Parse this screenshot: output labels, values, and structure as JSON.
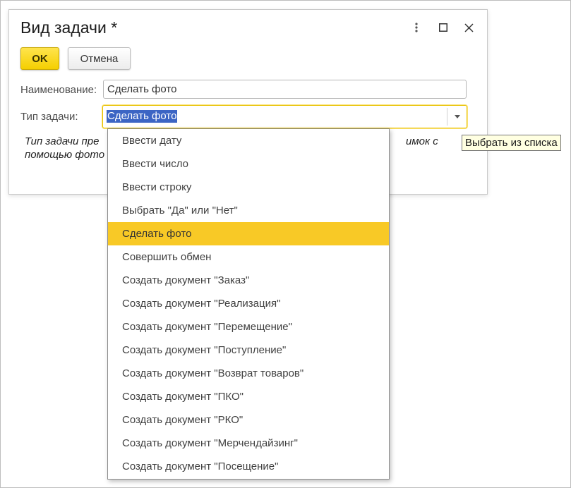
{
  "dialog": {
    "title": "Вид задачи *",
    "buttons": {
      "ok": "OK",
      "cancel": "Отмена"
    },
    "fields": {
      "name_label": "Наименование:",
      "name_value": "Сделать фото",
      "type_label": "Тип задачи:",
      "type_value": "Сделать фото"
    },
    "description_line1": "Тип задачи пре",
    "description_line1_tail": "имок с",
    "description_line2": "помощью фото"
  },
  "dropdown": {
    "items": [
      "Ввести дату",
      "Ввести число",
      "Ввести строку",
      "Выбрать \"Да\" или \"Нет\"",
      "Сделать фото",
      "Совершить обмен",
      "Создать документ \"Заказ\"",
      "Создать документ \"Реализация\"",
      "Создать документ \"Перемещение\"",
      "Создать документ \"Поступление\"",
      "Создать документ \"Возврат товаров\"",
      "Создать документ \"ПКО\"",
      "Создать документ \"РКО\"",
      "Создать документ \"Мерчендайзинг\"",
      "Создать документ \"Посещение\""
    ],
    "selected_index": 4
  },
  "tooltip": {
    "text": "Выбрать из списка"
  },
  "colors": {
    "ok_button": "#f5cf00",
    "selection_highlight": "#f8c926",
    "text_selection": "#3c65c4",
    "tooltip_bg": "#ffffe1"
  },
  "icons": {
    "more": "more-vertical-icon",
    "maximize": "maximize-icon",
    "close": "close-icon",
    "dropdown": "chevron-down-icon"
  }
}
